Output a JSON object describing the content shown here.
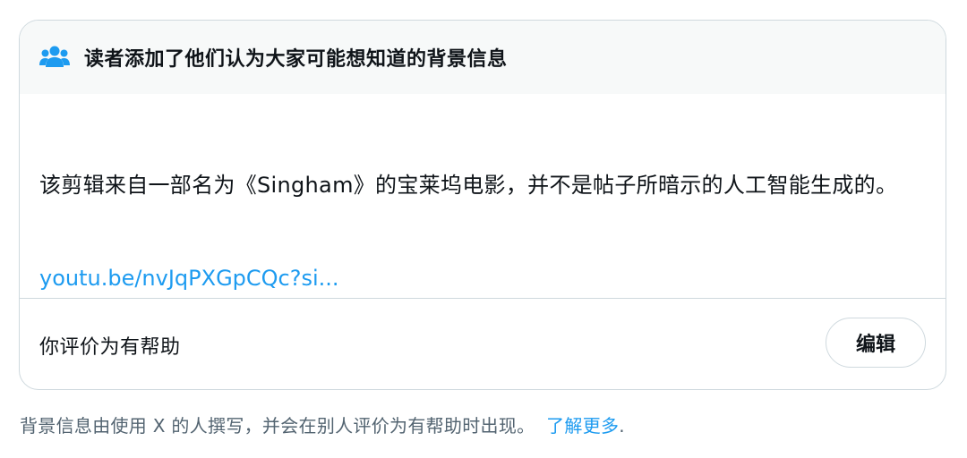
{
  "note": {
    "header_title": "读者添加了他们认为大家可能想知道的背景信息",
    "header_icon": "people-icon",
    "body_text": "该剪辑来自一部名为《Singham》的宝莱坞电影，并不是帖子所暗示的人工智能生成的。",
    "link_text": "youtu.be/nvJqPXGpCQc?si...",
    "rated_status": "你评价为有帮助",
    "edit_label": "编辑"
  },
  "footer": {
    "disclaimer_text": "背景信息由使用 X 的人撰写，并会在别人评价为有帮助时出现。",
    "learn_more_label": "了解更多",
    "trailing_period": "."
  },
  "colors": {
    "accent": "#1d9bf0",
    "border": "#cfd9de",
    "header_bg": "#f7f9f9",
    "text": "#0f1419",
    "secondary_text": "#536471"
  }
}
